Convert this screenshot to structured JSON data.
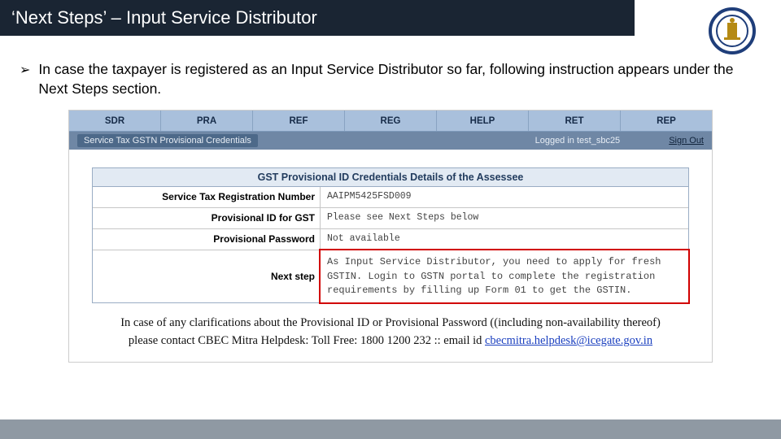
{
  "title": "‘Next Steps’ – Input Service Distributor",
  "bullet": "In case the taxpayer is registered as an Input Service Distributor so far, following instruction appears under the Next Steps section.",
  "nav": [
    "SDR",
    "PRA",
    "REF",
    "REG",
    "HELP",
    "RET",
    "REP"
  ],
  "status": {
    "breadcrumb": "Service Tax GSTN Provisional Credentials",
    "logged_in": "Logged in test_sbc25",
    "signout": "Sign Out"
  },
  "panel_header": "GST Provisional ID Credentials Details of the Assessee",
  "rows": {
    "r1": {
      "label": "Service Tax Registration Number",
      "value": "AAIPM5425FSD009"
    },
    "r2": {
      "label": "Provisional ID for GST",
      "value": "Please see Next Steps below"
    },
    "r3": {
      "label": "Provisional Password",
      "value": "Not available"
    },
    "r4": {
      "label": "Next step",
      "value": "As Input Service Distributor, you need to apply for fresh GSTIN. Login to GSTN portal to complete the registration requirements by filling up Form 01 to get the GSTIN."
    }
  },
  "footnote": {
    "line1": "In case of any clarifications about the Provisional ID or Provisional Password ((including non-availability thereof)",
    "line2a": "please contact CBEC Mitra Helpdesk: Toll Free: 1800 1200 232 :: email id ",
    "link": "cbecmitra.helpdesk@icegate.gov.in"
  },
  "logo_colors": {
    "ring": "#1f3e7a",
    "emblem": "#b58a14"
  }
}
